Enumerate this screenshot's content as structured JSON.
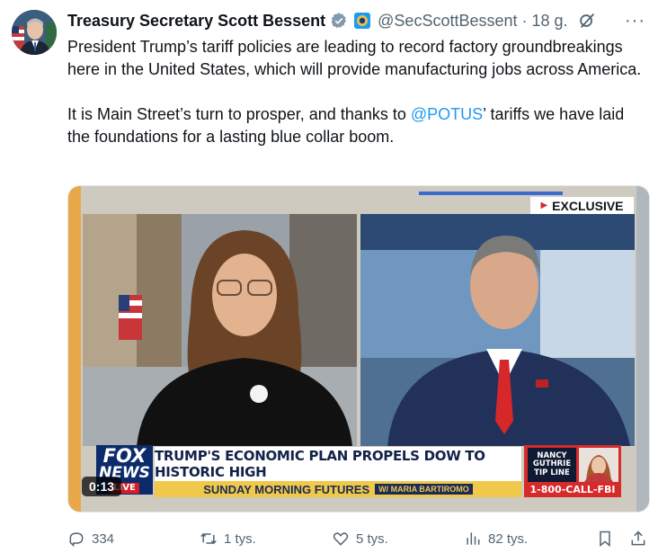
{
  "author": {
    "name": "Treasury Secretary Scott Bessent",
    "handle": "@SecScottBessent",
    "separator": "·",
    "time": "18 g.",
    "more": "···"
  },
  "tweet": {
    "paragraph1": "President Trump’s tariff policies are leading to record factory groundbreakings here in the United States, which will provide manufacturing jobs across America.",
    "paragraph2_before": "It is Main Street’s turn to prosper, and thanks to ",
    "mention": "@POTUS",
    "paragraph2_after": "’ tariffs we have laid the foundations for a lasting blue collar boom."
  },
  "video": {
    "badge": "EXCLUSIVE",
    "network_line1": "FOX",
    "network_line2": "NEWS",
    "network_line3": "LIVE",
    "headline": "TRUMP'S ECONOMIC PLAN PROPELS DOW TO HISTORIC HIGH",
    "show": "SUNDAY MORNING FUTURES",
    "host": "W/ MARIA BARTIROMO",
    "tipline_name1": "NANCY",
    "tipline_name2": "GUTHRIE",
    "tipline_label1": "TIP LINE",
    "tipline_phone": "1-800-CALL-FBI",
    "duration": "0:13"
  },
  "actions": {
    "replies": "334",
    "reposts": "1 tys.",
    "likes": "5 tys.",
    "views": "82 tys."
  },
  "colors": {
    "accent": "#1d9bf0",
    "muted": "#536471",
    "text": "#0f1419",
    "fox_red": "#d21f27",
    "fox_blue": "#0b2b6b"
  }
}
